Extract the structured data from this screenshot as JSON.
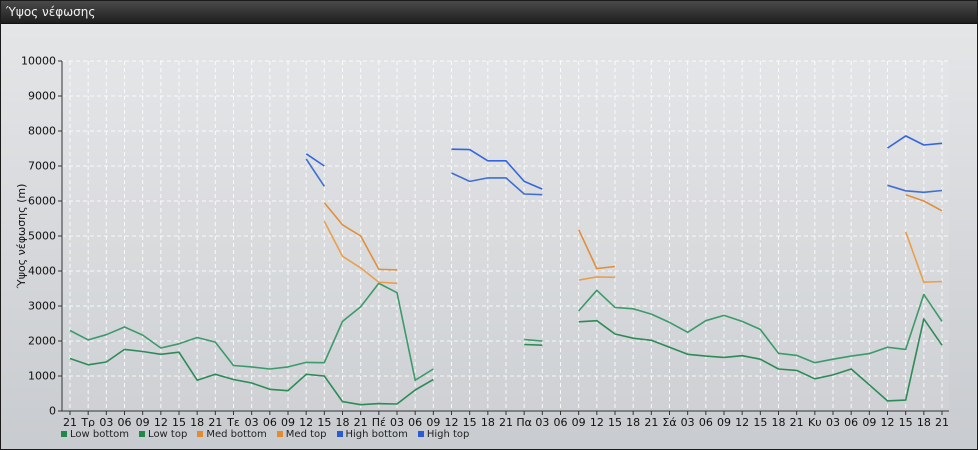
{
  "window": {
    "title": "Ύψος νέφωσης"
  },
  "chart_data": {
    "type": "line",
    "title": "",
    "xlabel": "",
    "ylabel": "Ύψος νέφωσης (m)",
    "ylim": [
      0,
      10000
    ],
    "yticks": [
      0,
      1000,
      2000,
      3000,
      4000,
      5000,
      6000,
      7000,
      8000,
      9000,
      10000
    ],
    "grid": true,
    "legend_position": "bottom-left",
    "categories": [
      "21",
      "Τρ",
      "03",
      "06",
      "09",
      "12",
      "15",
      "18",
      "21",
      "Τε",
      "03",
      "06",
      "09",
      "12",
      "15",
      "18",
      "21",
      "Πέ",
      "03",
      "06",
      "09",
      "12",
      "15",
      "18",
      "21",
      "Πα",
      "03",
      "06",
      "09",
      "12",
      "15",
      "18",
      "21",
      "Σά",
      "03",
      "06",
      "09",
      "12",
      "15",
      "18",
      "21",
      "Κυ",
      "03",
      "06",
      "09",
      "12",
      "15",
      "18",
      "21"
    ],
    "series": [
      {
        "name": "Low bottom",
        "color": "#2e8b57",
        "values": [
          1500,
          1320,
          1400,
          1760,
          1700,
          1620,
          1680,
          880,
          1050,
          900,
          800,
          620,
          580,
          1050,
          1000,
          270,
          180,
          210,
          200,
          600,
          900,
          null,
          null,
          null,
          null,
          1900,
          1880,
          null,
          2550,
          2580,
          2200,
          2080,
          2020,
          1820,
          1620,
          1570,
          1530,
          1580,
          1480,
          1200,
          1160,
          920,
          1030,
          1200,
          750,
          290,
          310,
          2630,
          1880
        ]
      },
      {
        "name": "Low top",
        "color": "#3d9a6a",
        "values": [
          2300,
          2030,
          2180,
          2400,
          2170,
          1800,
          1920,
          2100,
          1970,
          1300,
          1260,
          1200,
          1260,
          1390,
          1380,
          2560,
          2980,
          3650,
          3380,
          880,
          1200,
          null,
          null,
          null,
          null,
          2040,
          2000,
          null,
          2860,
          3450,
          2960,
          2920,
          2770,
          2530,
          2250,
          2580,
          2730,
          2560,
          2330,
          1650,
          1590,
          1380,
          1480,
          1570,
          1640,
          1820,
          1760,
          3330,
          2560
        ]
      },
      {
        "name": "Med bottom",
        "color": "#e8a050",
        "values": [
          null,
          null,
          null,
          null,
          null,
          null,
          null,
          null,
          null,
          null,
          null,
          null,
          null,
          null,
          5420,
          4420,
          4090,
          3680,
          3650,
          null,
          null,
          null,
          null,
          null,
          null,
          null,
          null,
          null,
          3740,
          3830,
          3820,
          null,
          null,
          null,
          null,
          null,
          null,
          null,
          null,
          null,
          null,
          null,
          null,
          null,
          null,
          null,
          5120,
          3680,
          3700
        ]
      },
      {
        "name": "Med top",
        "color": "#e08f3c",
        "values": [
          null,
          null,
          null,
          null,
          null,
          null,
          null,
          null,
          null,
          null,
          null,
          null,
          null,
          null,
          5950,
          5320,
          5000,
          4050,
          4030,
          null,
          null,
          null,
          null,
          null,
          null,
          null,
          null,
          null,
          5180,
          4070,
          4130,
          null,
          null,
          null,
          null,
          null,
          null,
          null,
          null,
          null,
          null,
          null,
          null,
          null,
          null,
          null,
          6180,
          6000,
          5720
        ]
      },
      {
        "name": "High bottom",
        "color": "#3f6fcf",
        "values": [
          null,
          null,
          null,
          null,
          null,
          null,
          null,
          null,
          null,
          null,
          null,
          null,
          null,
          7200,
          6420,
          null,
          null,
          null,
          null,
          null,
          null,
          6800,
          6560,
          6660,
          6660,
          6200,
          6180,
          null,
          null,
          null,
          null,
          null,
          null,
          null,
          null,
          null,
          null,
          null,
          null,
          null,
          null,
          null,
          null,
          null,
          null,
          6450,
          6290,
          6250,
          6300
        ]
      },
      {
        "name": "High top",
        "color": "#3366dd",
        "values": [
          null,
          null,
          null,
          null,
          null,
          null,
          null,
          null,
          null,
          null,
          null,
          null,
          null,
          7350,
          7000,
          null,
          null,
          null,
          null,
          null,
          null,
          7480,
          7470,
          7150,
          7150,
          6560,
          6340,
          null,
          null,
          null,
          null,
          null,
          null,
          null,
          null,
          null,
          null,
          null,
          null,
          null,
          null,
          null,
          null,
          null,
          null,
          7510,
          7860,
          7600,
          7650
        ]
      }
    ],
    "legend": [
      {
        "label": "Low bottom",
        "color": "#22884a"
      },
      {
        "label": "Low top",
        "color": "#22884a"
      },
      {
        "label": "Med bottom",
        "color": "#e68a2e"
      },
      {
        "label": "Med top",
        "color": "#e68a2e"
      },
      {
        "label": "High bottom",
        "color": "#2a5bd7"
      },
      {
        "label": "High top",
        "color": "#2a5bd7"
      }
    ]
  }
}
